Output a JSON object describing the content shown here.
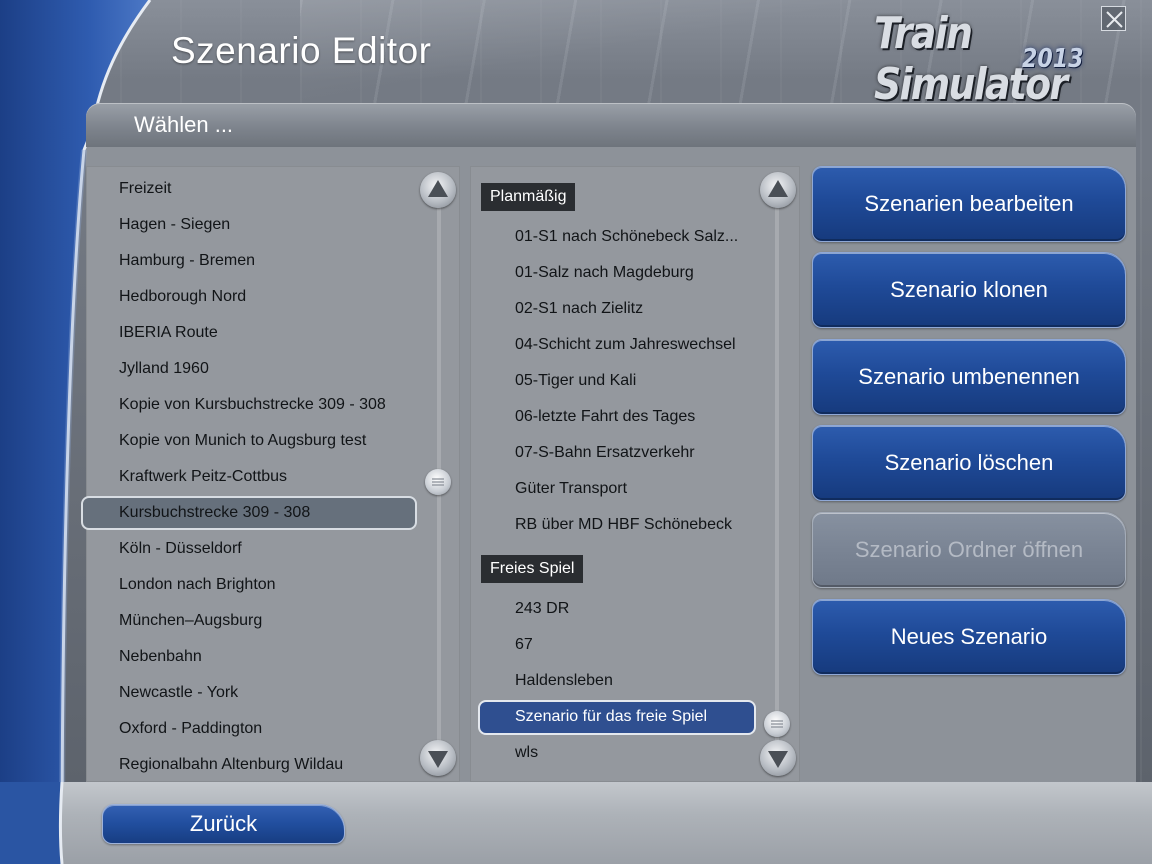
{
  "header": {
    "title": "Szenario Editor",
    "logo_text": "Train Simulator",
    "logo_year": "2013"
  },
  "choose_bar": {
    "label": "Wählen ..."
  },
  "routes": {
    "items": [
      "Freizeit",
      "Hagen - Siegen",
      "Hamburg - Bremen",
      "Hedborough Nord",
      "IBERIA Route",
      "Jylland 1960",
      "Kopie von Kursbuchstrecke 309 - 308",
      "Kopie von Munich to Augsburg test",
      "Kraftwerk Peitz-Cottbus",
      "Kursbuchstrecke 309 - 308",
      "Köln - Düsseldorf",
      "London nach Brighton",
      "München–Augsburg",
      "Nebenbahn",
      "Newcastle - York",
      "Oxford - Paddington",
      "Regionalbahn Altenburg Wildau"
    ],
    "selected": "Kursbuchstrecke 309 - 308"
  },
  "scenarios": {
    "groups": [
      {
        "header": "Planmäßig",
        "items": [
          "01-S1 nach Schönebeck Salz...",
          "01-Salz nach Magdeburg",
          "02-S1 nach Zielitz",
          "04-Schicht zum Jahreswechsel",
          "05-Tiger und Kali",
          "06-letzte Fahrt des Tages",
          "07-S-Bahn Ersatzverkehr",
          "Güter Transport",
          "RB über MD HBF Schönebeck"
        ]
      },
      {
        "header": "Freies Spiel",
        "items": [
          "243 DR",
          "67",
          "Haldensleben",
          "Szenario für das freie Spiel",
          "wls"
        ]
      }
    ],
    "selected": "Szenario für das freie Spiel"
  },
  "actions": {
    "edit": "Szenarien bearbeiten",
    "clone": "Szenario klonen",
    "rename": "Szenario umbenennen",
    "delete": "Szenario löschen",
    "open_folder": "Szenario Ordner öffnen",
    "new": "Neues Szenario"
  },
  "footer": {
    "back": "Zurück"
  },
  "colors": {
    "button_blue": "#1f4a98",
    "button_disabled": "#7a8494",
    "panel_grey": "#94989e",
    "selected_blue": "#2f4f90",
    "group_header": "#2a2d31"
  }
}
